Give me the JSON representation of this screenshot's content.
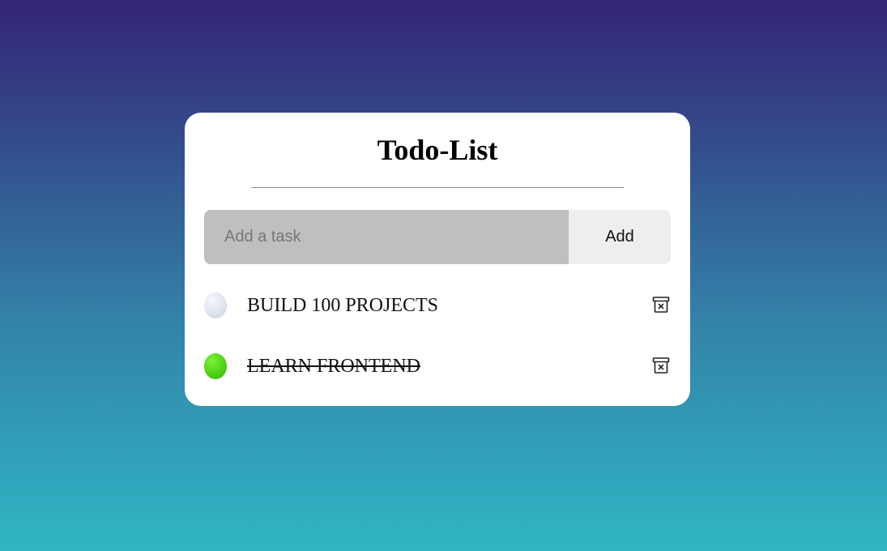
{
  "app": {
    "title": "Todo-List"
  },
  "input": {
    "placeholder": "Add a task",
    "value": "",
    "add_label": "Add"
  },
  "tasks": [
    {
      "text": "BUILD 100 PROJECTS",
      "completed": false,
      "delete_icon": "archive-x-icon"
    },
    {
      "text": "LEARN FRONTEND",
      "completed": true,
      "delete_icon": "archive-x-icon"
    }
  ],
  "colors": {
    "background_top": "#342477",
    "background_bottom": "#2fb6c4",
    "card": "#ffffff",
    "input_bg": "#bfbfbf",
    "button_bg": "#eeeeee",
    "checked": "#4fd114",
    "unchecked": "#dfe4ef"
  }
}
